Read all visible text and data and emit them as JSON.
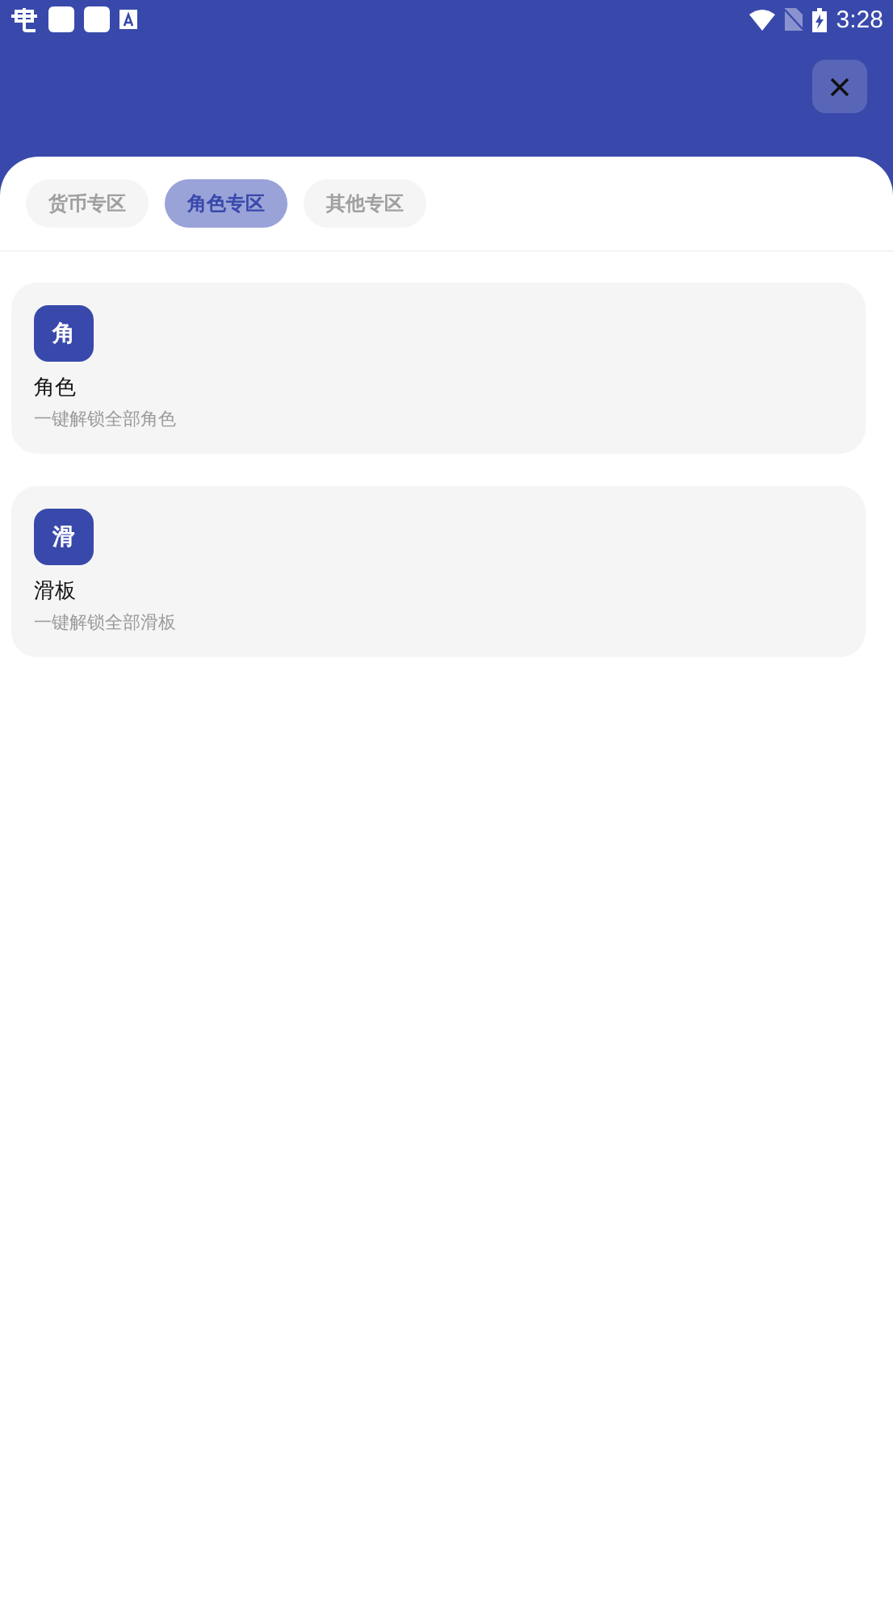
{
  "status_bar": {
    "time": "3:28"
  },
  "tabs": [
    {
      "label": "货币专区",
      "selected": false
    },
    {
      "label": "角色专区",
      "selected": true
    },
    {
      "label": "其他专区",
      "selected": false
    }
  ],
  "items": [
    {
      "badge": "角",
      "title": "角色",
      "subtitle": "一键解锁全部角色"
    },
    {
      "badge": "滑",
      "title": "滑板",
      "subtitle": "一键解锁全部滑板"
    }
  ]
}
